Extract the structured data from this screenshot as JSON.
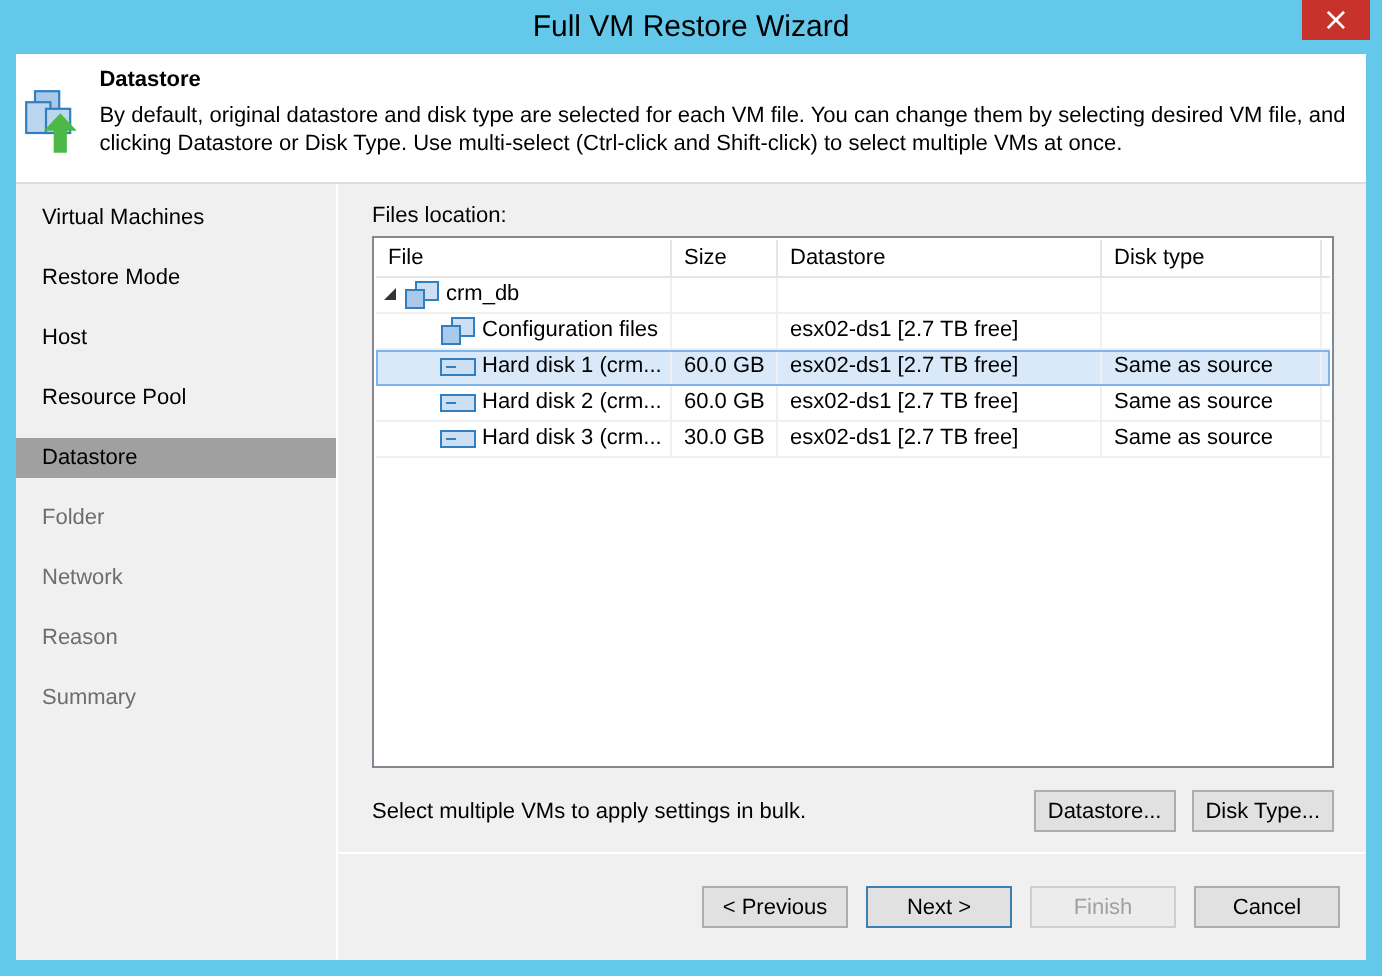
{
  "window": {
    "title": "Full VM Restore Wizard",
    "close": "×"
  },
  "header": {
    "title": "Datastore",
    "description": "By default, original datastore and disk type are selected for each VM file. You can change them by selecting desired VM file, and clicking Datastore or Disk Type. Use multi-select (Ctrl-click and Shift-click) to select multiple VMs at once."
  },
  "sidebar": {
    "items": [
      {
        "label": "Virtual Machines",
        "selected": false,
        "disabled": false
      },
      {
        "label": "Restore Mode",
        "selected": false,
        "disabled": false
      },
      {
        "label": "Host",
        "selected": false,
        "disabled": false
      },
      {
        "label": "Resource Pool",
        "selected": false,
        "disabled": false
      },
      {
        "label": "Datastore",
        "selected": true,
        "disabled": false
      },
      {
        "label": "Folder",
        "selected": false,
        "disabled": true
      },
      {
        "label": "Network",
        "selected": false,
        "disabled": true
      },
      {
        "label": "Reason",
        "selected": false,
        "disabled": true
      },
      {
        "label": "Summary",
        "selected": false,
        "disabled": true
      }
    ]
  },
  "files_location": {
    "label": "Files location:",
    "table": {
      "columns": [
        "File",
        "Size",
        "Datastore",
        "Disk type"
      ],
      "rows": [
        {
          "kind": "vm",
          "file": "crm_db",
          "expanded": true,
          "selected": false,
          "children": [
            {
              "kind": "config",
              "file": "Configuration files",
              "datastore": "esx02-ds1 [2.7 TB free]",
              "selected": false
            },
            {
              "kind": "disk",
              "file": "Hard disk 1 (crm...",
              "size": "60.0 GB",
              "datastore": "esx02-ds1 [2.7 TB free]",
              "disk_type": "Same as source",
              "selected": true
            },
            {
              "kind": "disk",
              "file": "Hard disk 2 (crm...",
              "size": "60.0 GB",
              "datastore": "esx02-ds1 [2.7 TB free]",
              "disk_type": "Same as source",
              "selected": false
            },
            {
              "kind": "disk",
              "file": "Hard disk 3 (crm...",
              "size": "30.0 GB",
              "datastore": "esx02-ds1 [2.7 TB free]",
              "disk_type": "Same as source",
              "selected": false
            }
          ]
        }
      ]
    }
  },
  "bulk_hint": "Select multiple VMs to apply settings in bulk.",
  "bulk_buttons": [
    {
      "label": "Datastore...",
      "disabled": false
    },
    {
      "label": "Disk Type...",
      "disabled": false
    }
  ],
  "footer_buttons": [
    {
      "label": "< Previous",
      "disabled": false,
      "default": false
    },
    {
      "label": "Next >",
      "disabled": false,
      "default": true
    },
    {
      "label": "Finish",
      "disabled": true,
      "default": false
    },
    {
      "label": "Cancel",
      "disabled": false,
      "default": false
    }
  ]
}
